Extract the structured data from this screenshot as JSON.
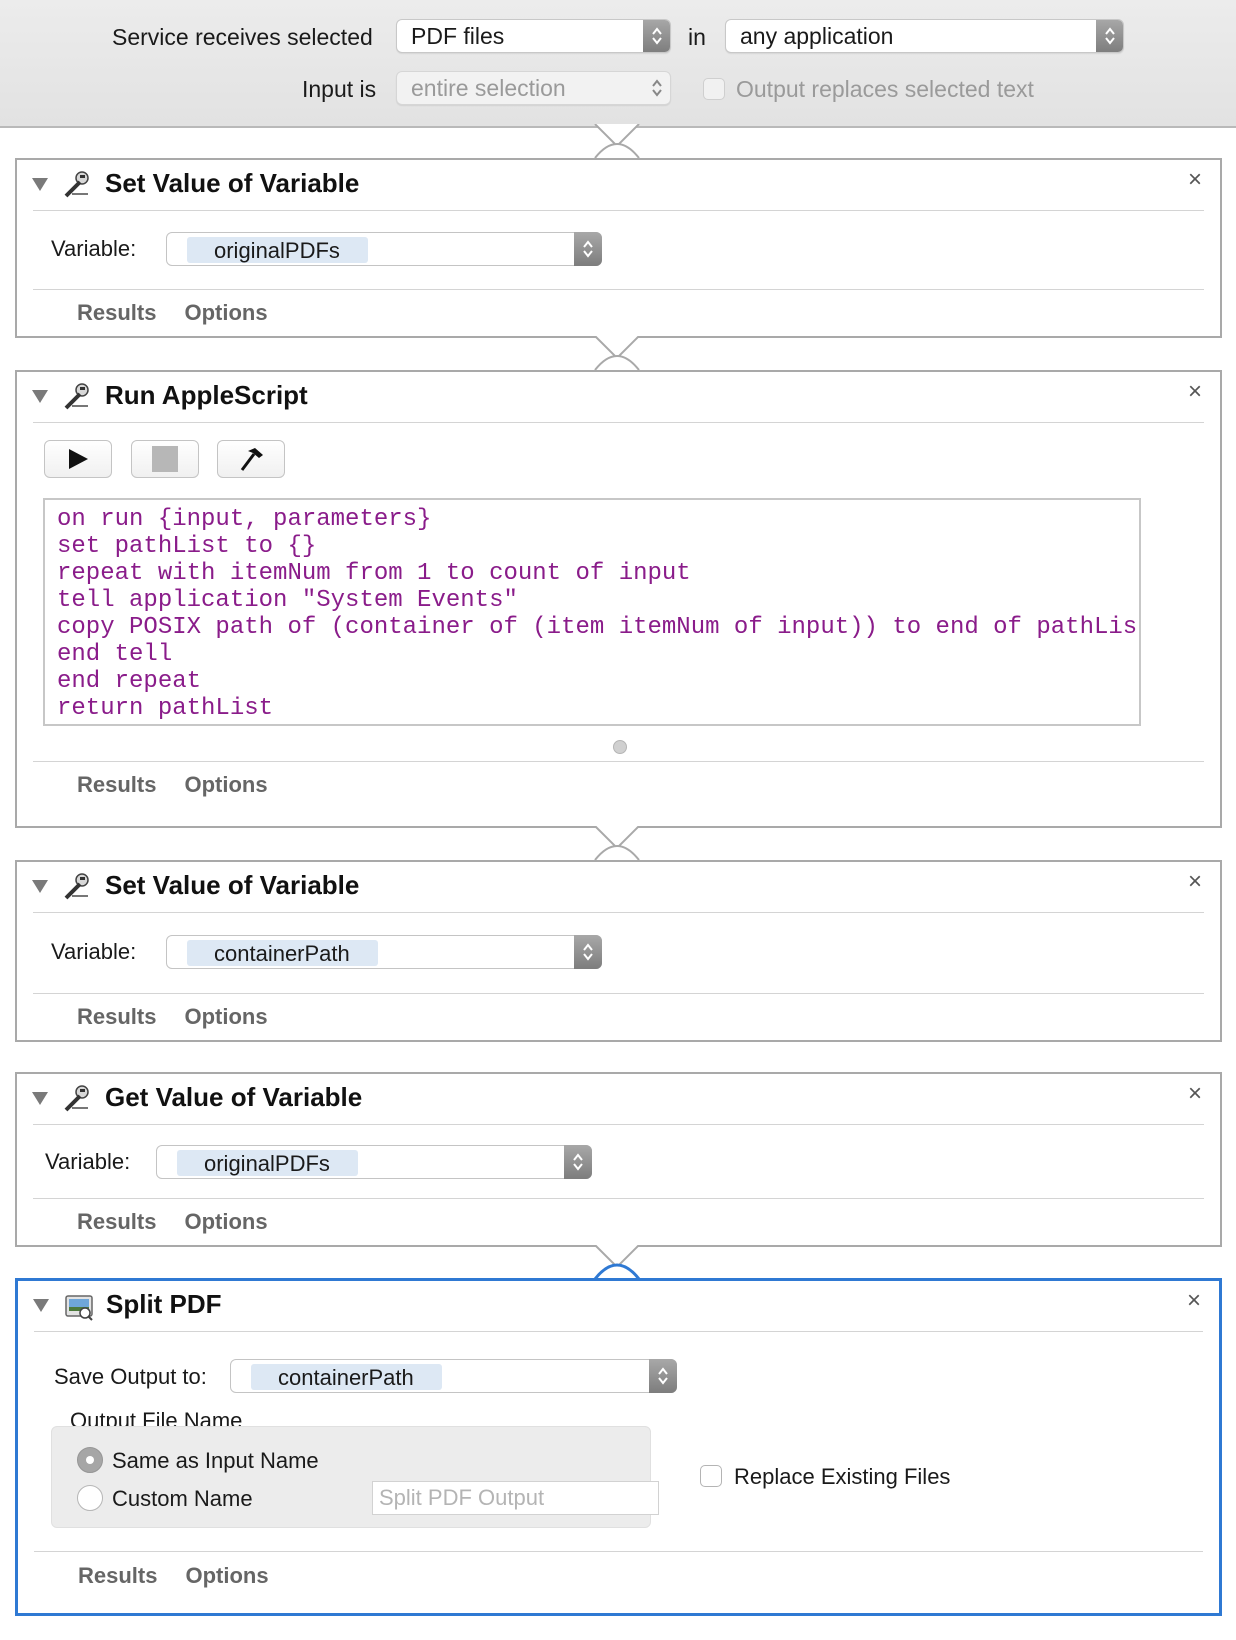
{
  "header": {
    "service_label": "Service receives selected",
    "service_value": "PDF files",
    "in_label": "in",
    "app_value": "any application",
    "input_label": "Input is",
    "input_value": "entire selection",
    "output_replaces_label": "Output replaces selected text"
  },
  "actions": [
    {
      "title": "Set Value of Variable",
      "icon": "automator-robot-icon",
      "field_label": "Variable:",
      "variable": "originalPDFs",
      "tabs": [
        "Results",
        "Options"
      ]
    },
    {
      "title": "Run AppleScript",
      "icon": "automator-robot-icon",
      "toolbar": [
        "run-icon",
        "stop-icon",
        "compile-hammer-icon"
      ],
      "code": [
        "on run {input, parameters}",
        "set pathList to {}",
        "repeat with itemNum from 1 to count of input",
        "tell application \"System Events\"",
        "copy POSIX path of (container of (item itemNum of input)) to end of pathList",
        "end tell",
        "end repeat",
        "return pathList"
      ],
      "tabs": [
        "Results",
        "Options"
      ]
    },
    {
      "title": "Set Value of Variable",
      "icon": "automator-robot-icon",
      "field_label": "Variable:",
      "variable": "containerPath",
      "tabs": [
        "Results",
        "Options"
      ]
    },
    {
      "title": "Get Value of Variable",
      "icon": "automator-robot-icon",
      "field_label": "Variable:",
      "variable": "originalPDFs",
      "tabs": [
        "Results",
        "Options"
      ]
    },
    {
      "title": "Split PDF",
      "icon": "preview-pdf-icon",
      "save_label": "Save Output to:",
      "save_value": "containerPath",
      "output_file_name_label": "Output File Name",
      "option_same": "Same as Input Name",
      "option_custom": "Custom Name",
      "custom_placeholder": "Split PDF Output",
      "replace_label": "Replace Existing Files",
      "tabs": [
        "Results",
        "Options"
      ]
    }
  ],
  "close_glyph": "×",
  "colors": {
    "selection_border": "#2f79d3",
    "code_text": "#8a1c8a",
    "token_bg": "#dde8f4"
  }
}
